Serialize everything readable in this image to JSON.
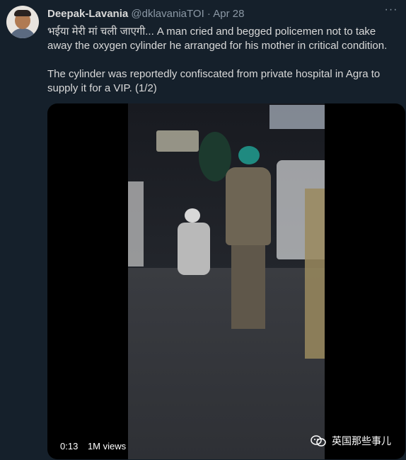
{
  "tweet": {
    "display_name": "Deepak-Lavania",
    "handle": "@dklavaniaTOI",
    "separator": "·",
    "date": "Apr 28",
    "more_icon": "ellipsis-icon",
    "text_line1": "भईया मेरी मां चली जाएगी... A man cried and begged policemen not to take away the oxygen cylinder he arranged for his mother in critical condition.",
    "text_line2": "The cylinder was reportedly confiscated from private hospital in Agra to supply it for a VIP. (1/2)"
  },
  "video": {
    "time": "0:13",
    "views": "1M views"
  },
  "watermark": {
    "text": "英国那些事儿",
    "icon": "wechat-icon"
  },
  "colors": {
    "background": "#15202b",
    "text": "#d9d9d9",
    "muted": "#8b98a5"
  }
}
